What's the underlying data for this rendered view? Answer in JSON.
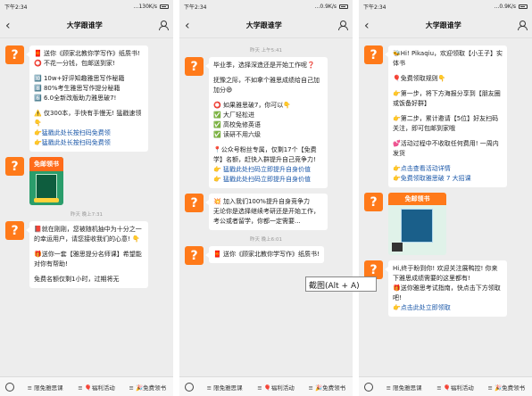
{
  "tooltip": "截图(Alt + A)",
  "panels": [
    {
      "status": {
        "time": "下午2:34",
        "net": "...130K/s"
      },
      "title": "大学跟谁学",
      "msgs": [
        {
          "type": "text",
          "lines": [
            {
              "t": "🧧 送你《顾家北教你学写作》纸质书!"
            },
            {
              "t": "⭕ 不花一分钱，包邮送到家!"
            },
            {
              "t": ""
            },
            {
              "t": "🔟 10w+好评知趣雅思写作秘籍"
            },
            {
              "t": "8️⃣ 80%考生雅思写作提分秘籍"
            },
            {
              "t": "6️⃣ 6.0全新改版助力雅思破7!"
            },
            {
              "t": ""
            },
            {
              "t": "⚠️ 仅300本，手快有手慢无! 猛戳速领👇"
            },
            {
              "t": "👉猛戳此处长按扫码免费领",
              "link": true
            },
            {
              "t": "👉猛戳此处长按扫码免费领",
              "link": true
            }
          ]
        },
        {
          "type": "poster",
          "label": "免邮领书"
        },
        {
          "type": "time",
          "text": "昨天 晚上7:31"
        },
        {
          "type": "text",
          "lines": [
            {
              "t": "📕就在刚刚，您被随机抽中为十分之一的幸运用户，请您接收我们的心意! 👇"
            },
            {
              "t": ""
            },
            {
              "t": "🎁送你一套【雅思提分名师课】希望能对你有帮助!"
            },
            {
              "t": ""
            },
            {
              "t": "免费名额仅剩1小时，过期将无"
            }
          ]
        }
      ],
      "bottom": [
        "☰",
        "≡ 限免雅思课",
        "≡ 🎈福利活动",
        "≡ 🎉免费领书"
      ]
    },
    {
      "status": {
        "time": "下午2:34",
        "net": "...0.9K/s"
      },
      "title": "大学跟谁学",
      "msgs": [
        {
          "type": "time",
          "text": "昨天 上午5:41"
        },
        {
          "type": "text",
          "lines": [
            {
              "t": "毕业季，选择深造还是开始工作呢❓"
            },
            {
              "t": ""
            },
            {
              "t": "抚豫之际，不如拿个雅思成绩给自己加加分😄"
            },
            {
              "t": ""
            },
            {
              "t": "⭕ 如果雅思破7，你可以👇"
            },
            {
              "t": "✅ 大厂轻松进"
            },
            {
              "t": "✅ 高校免修英语"
            },
            {
              "t": "✅ 读研不用六级"
            },
            {
              "t": ""
            },
            {
              "t": "📍公众号粉丝专属，仅剩17个【免费学】名额，赶快入群提升自己竞争力!"
            },
            {
              "t": "👉 猛戳此处扫码立即提升自身价值",
              "link": true
            },
            {
              "t": "👉 猛戳此处扫码立即提升自身价值",
              "link": true
            }
          ]
        },
        {
          "type": "text",
          "lines": [
            {
              "t": "💥 加入我们100%提升自身竞争力"
            },
            {
              "t": "无论你是选择继续考研还是开始工作，考公或者留学，你都一定需要..."
            }
          ]
        },
        {
          "type": "time",
          "text": "昨天 晚上6:01"
        },
        {
          "type": "text",
          "lines": [
            {
              "t": "🧧 送你《顾家北教你学写作》纸质书!"
            }
          ]
        }
      ],
      "bottom": [
        "☰",
        "≡ 限免雅思课",
        "≡ 🎈福利活动",
        "≡ 🎉免费领书"
      ]
    },
    {
      "status": {
        "time": "下午2:34",
        "net": "...0.9K/s"
      },
      "title": "大学跟谁学",
      "msgs": [
        {
          "type": "text",
          "lines": [
            {
              "t": "🐝Hi! Pikaqiu，欢迎领取【小王子】实体书"
            },
            {
              "t": ""
            },
            {
              "t": "🎈免费领取规则👇"
            },
            {
              "t": ""
            },
            {
              "t": "👉第一步，将下方海报分享到【朋友圈或饭备好群】"
            },
            {
              "t": ""
            },
            {
              "t": "👉第二步，累计邀请【5位】好友扫码关注，即可包邮到家哦"
            },
            {
              "t": ""
            },
            {
              "t": "💕活动过程中不收取任何费用! 一周内发货"
            },
            {
              "t": ""
            },
            {
              "t": "👉点击查看活动详情",
              "link": true
            },
            {
              "t": "👉免费领取雅思破 7 大招课",
              "link": true
            }
          ]
        },
        {
          "type": "poster2",
          "label": "免邮领书"
        },
        {
          "type": "text",
          "lines": [
            {
              "t": "Hi,终于盼到你! 欢迎关注展鸭控! 你来下雅思成绩需要的这里都有!"
            },
            {
              "t": "🎁送你雅思考试指南，快点击下方领取吧!"
            },
            {
              "t": "👉点击此处立即领取",
              "link": true
            }
          ]
        }
      ],
      "bottom": [
        "☰",
        "≡ 限免雅思课",
        "≡ 🎈福利活动",
        "≡ 🎉免费领书"
      ]
    }
  ]
}
